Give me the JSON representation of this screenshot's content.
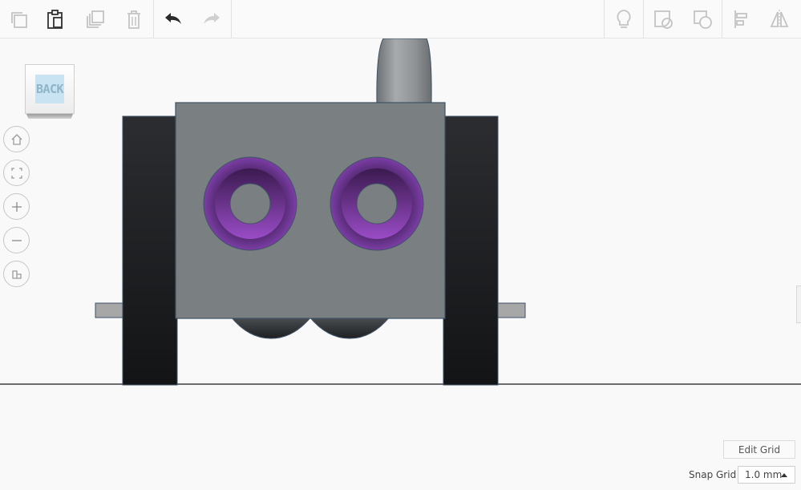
{
  "toolbar": {
    "left_tools": [
      "copy",
      "paste",
      "duplicate",
      "delete"
    ],
    "history_tools": [
      "undo",
      "redo"
    ],
    "right_tools": [
      "light-bulb",
      "shape-hole",
      "shape-group",
      "align",
      "mirror"
    ]
  },
  "viewcube": {
    "face_label": "BACK"
  },
  "nav": [
    "home",
    "fit",
    "zoom-in",
    "zoom-out",
    "perspective"
  ],
  "grid": {
    "edit_label": "Edit Grid",
    "snap_label": "Snap Grid",
    "snap_value": "1.0 mm"
  },
  "colors": {
    "body": "#7a7f82",
    "wheel": "#1f2124",
    "eye": "#6a2c8c",
    "tail": "#8f9396",
    "axle": "#a7a7a7"
  }
}
